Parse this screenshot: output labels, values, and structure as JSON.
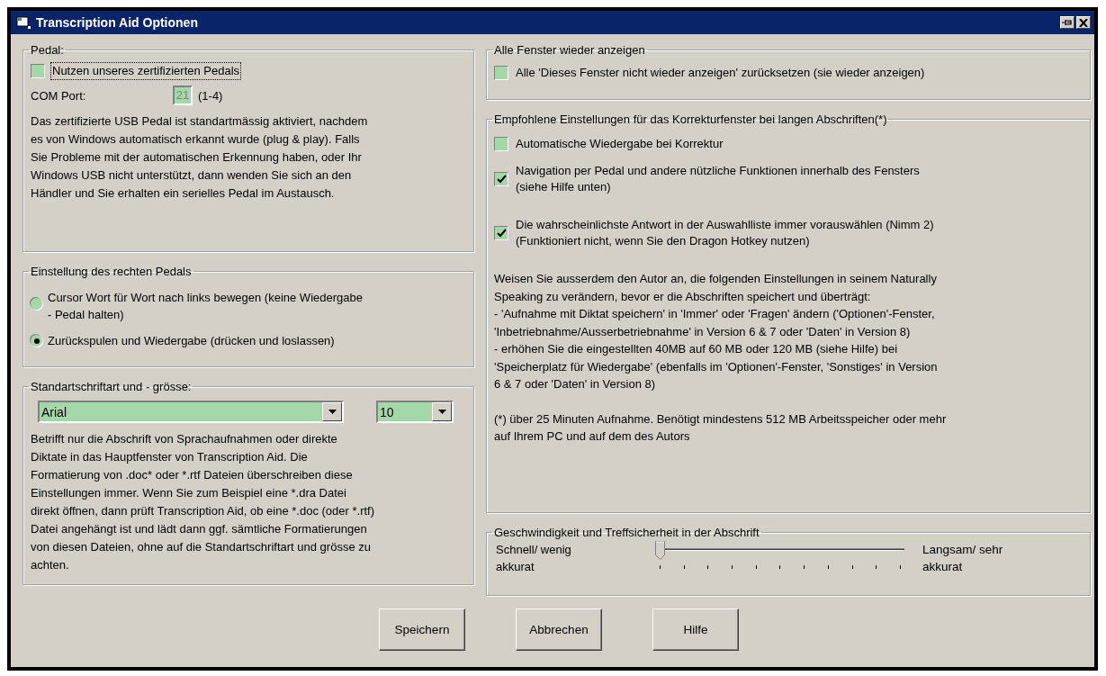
{
  "window": {
    "title": "Transcription Aid Optionen"
  },
  "pedal": {
    "title": "Pedal:",
    "use_pedal": {
      "label": "Nutzen unseres zertifizierten Pedals",
      "checked": false,
      "focused": true
    },
    "com_port": {
      "label": "COM Port:",
      "value": "21",
      "disabled": true,
      "range": "(1-4)"
    },
    "note": "Das zertifizierte USB Pedal ist standartmässig aktiviert, nachdem\nes von Windows automatisch erkannt wurde (plug & play). Falls\nSie Probleme mit der automatischen Erkennung haben, oder Ihr\nWindows USB nicht unterstützt, dann wenden Sie sich an den\nHändler und Sie erhalten ein serielles Pedal im Austausch."
  },
  "right_pedal": {
    "title": "Einstellung des rechten Pedals",
    "options": [
      {
        "label": "Cursor Wort für Wort nach links bewegen (keine Wiedergabe\n- Pedal halten)",
        "selected": false
      },
      {
        "label": "Zurückspulen und Wiedergabe (drücken und loslassen)",
        "selected": true
      }
    ]
  },
  "font": {
    "title": "Standartschriftart und - grösse:",
    "family": {
      "value": "Arial"
    },
    "size": {
      "value": "10"
    },
    "note": "Betrifft nur die Abschrift von Sprachaufnahmen oder direkte\nDiktate in das Hauptfenster von Transcription Aid. Die\nFormatierung von .doc* oder *.rtf Dateien überschreiben diese\nEinstellungen immer.  Wenn Sie zum Beispiel eine *.dra Datei\ndirekt öffnen, dann prüft Transcription Aid, ob eine *.doc (oder *.rtf)\nDatei angehängt ist und lädt dann ggf. sämtliche Formatierungen\nvon diesen Dateien, ohne auf die Standartschriftart und grösse zu\nachten."
  },
  "show_windows": {
    "title": "Alle Fenster wieder anzeigen",
    "checkboxes": [
      {
        "label": "Alle 'Dieses Fenster nicht wieder anzeigen' zurücksetzen (sie wieder anzeigen)",
        "checked": false
      }
    ]
  },
  "recommended": {
    "title": "Empfohlene Einstellungen für das Korrekturfenster bei langen Abschriften(*)",
    "checkboxes": [
      {
        "label": "Automatische Wiedergabe bei Korrektur",
        "checked": false
      },
      {
        "label": "Navigation per Pedal und andere nützliche Funktionen innerhalb des Fensters\n(siehe Hilfe unten)",
        "checked": true
      },
      {
        "label": "Die wahrscheinlichste Antwort in der Auswahlliste immer vorauswählen (Nimm 2)\n(Funktioniert nicht, wenn Sie den Dragon Hotkey nutzen)",
        "checked": true
      }
    ],
    "note": "Weisen Sie ausserdem den Autor an, die folgenden Einstellungen in seinem Naturally\nSpeaking zu verändern, bevor er die Abschriften speichert und überträgt:\n- 'Aufnahme mit Diktat speichern' in 'Immer' oder 'Fragen' ändern ('Optionen'-Fenster,\n'Inbetriebnahme/Ausserbetriebnahme' in Version 6 & 7 oder 'Daten' in Version 8)\n- erhöhen Sie die eingestellten 40MB auf 60 MB oder 120 MB (siehe Hilfe) bei\n'Speicherplatz für Wiedergabe' (ebenfalls im 'Optionen'-Fenster, 'Sonstiges' in Version\n6 & 7 oder 'Daten' in Version 8)",
    "footnote": "(*) über 25 Minuten Aufnahme. Benötigt mindestens 512 MB Arbeitsspeicher oder mehr\nauf Ihrem PC und auf dem des Autors"
  },
  "speed": {
    "title": "Geschwindigkeit und Treffsicherheit in der Abschrift",
    "left_label": "Schnell/ wenig\nakkurat",
    "right_label": "Langsam/ sehr\nakkurat",
    "slider": {
      "level": 0
    }
  },
  "buttons": [
    "Speichern",
    "Abbrechen",
    "Hilfe"
  ]
}
